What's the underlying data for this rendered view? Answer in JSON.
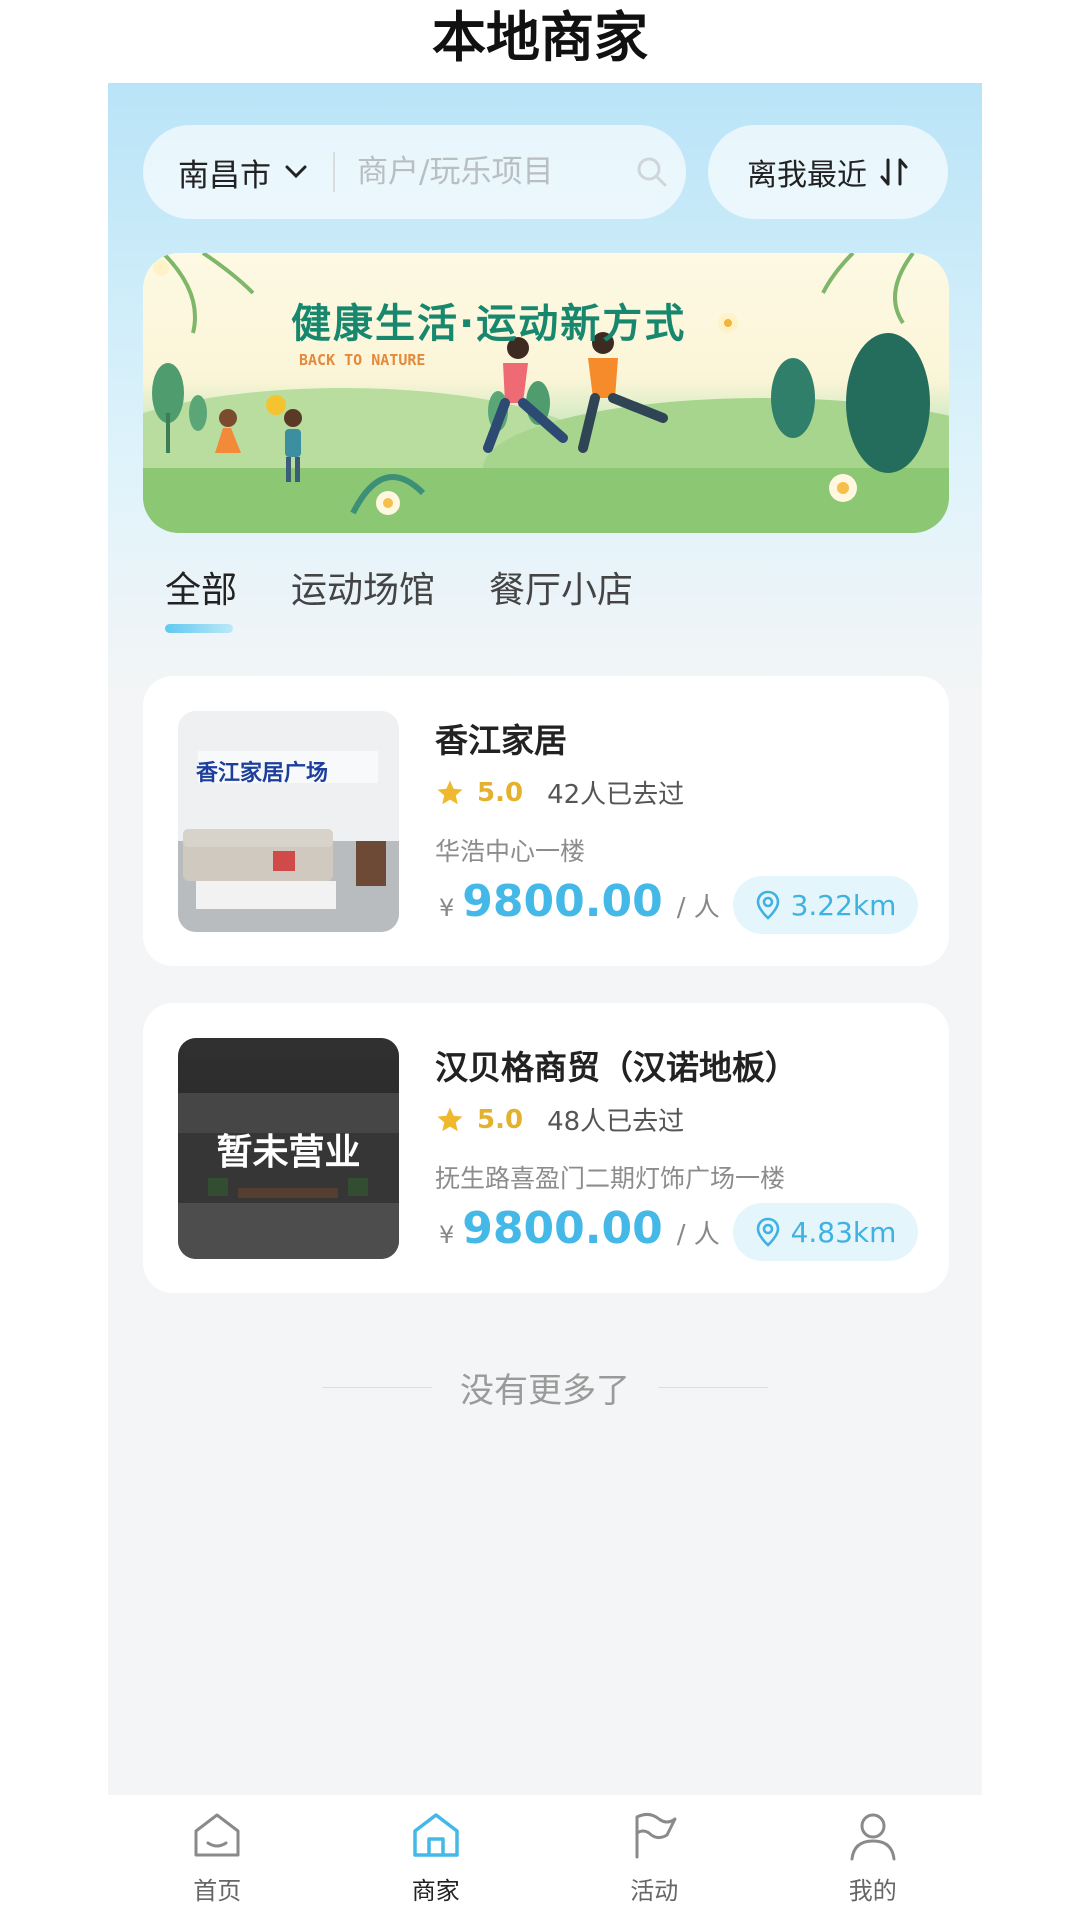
{
  "header": {
    "title": "本地商家"
  },
  "search": {
    "city": "南昌市",
    "placeholder": "商户/玩乐项目"
  },
  "sort": {
    "label": "离我最近"
  },
  "banner": {
    "title": "健康生活·运动新方式",
    "subtitle": "BACK TO NATURE"
  },
  "tabs": [
    {
      "label": "全部",
      "active": true
    },
    {
      "label": "运动场馆",
      "active": false
    },
    {
      "label": "餐厅小店",
      "active": false
    }
  ],
  "merchants": [
    {
      "name": "香江家居",
      "image_text": "香江家居广场",
      "rating": "5.0",
      "visits": "42人已去过",
      "address": "华浩中心一楼",
      "currency": "¥",
      "price": "9800.00",
      "unit": "/ 人",
      "distance": "3.22km"
    },
    {
      "name": "汉贝格商贸（汉诺地板）",
      "status": "暂未营业",
      "rating": "5.0",
      "visits": "48人已去过",
      "address": "抚生路喜盈门二期灯饰广场一楼",
      "currency": "¥",
      "price": "9800.00",
      "unit": "/ 人",
      "distance": "4.83km"
    }
  ],
  "list_end": "没有更多了",
  "nav": [
    {
      "label": "首页",
      "icon": "home-icon",
      "active": false
    },
    {
      "label": "商家",
      "icon": "shop-icon",
      "active": true
    },
    {
      "label": "活动",
      "icon": "flag-icon",
      "active": false
    },
    {
      "label": "我的",
      "icon": "user-icon",
      "active": false
    }
  ],
  "colors": {
    "accent": "#44b8e6",
    "star": "#e3b12d",
    "banner_title": "#17876e"
  }
}
